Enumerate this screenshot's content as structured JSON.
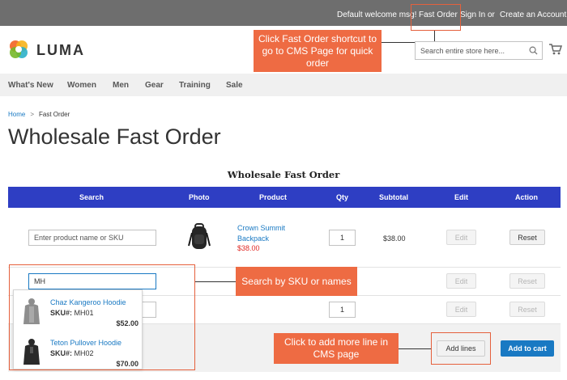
{
  "topbar": {
    "welcome": "Default welcome msg!",
    "fast_order": "Fast Order",
    "sign_in": "Sign In",
    "or": "or",
    "create_account": "Create an Account"
  },
  "logo": {
    "text": "LUMA"
  },
  "search": {
    "placeholder": "Search entire store here..."
  },
  "nav": [
    "What's New",
    "Women",
    "Men",
    "Gear",
    "Training",
    "Sale"
  ],
  "breadcrumb": {
    "home": "Home",
    "current": "Fast Order"
  },
  "page_title": "Wholesale Fast Order",
  "table": {
    "title": "Wholesale Fast Order",
    "headers": [
      "Search",
      "Photo",
      "Product",
      "Qty",
      "Subtotal",
      "Edit",
      "Action"
    ],
    "rows": [
      {
        "search_placeholder": "Enter product name or SKU",
        "product_name": "Crown Summit Backpack",
        "product_price": "$38.00",
        "qty": "1",
        "subtotal": "$38.00",
        "edit": "Edit",
        "action": "Reset"
      },
      {
        "search_value": "MH",
        "edit": "Edit",
        "action": "Reset"
      },
      {
        "qty": "1",
        "edit": "Edit",
        "action": "Reset"
      }
    ],
    "add_lines": "Add lines",
    "add_to_cart": "Add to cart"
  },
  "suggestions": [
    {
      "name": "Chaz Kangeroo Hoodie",
      "sku_label": "SKU#:",
      "sku": "MH01",
      "price": "$52.00",
      "color": "#8e8e8e"
    },
    {
      "name": "Teton Pullover Hoodie",
      "sku_label": "SKU#:",
      "sku": "MH02",
      "price": "$70.00",
      "color": "#2a2a2a"
    }
  ],
  "callouts": {
    "fast_order": "Click Fast Order shortcut to go to CMS Page for quick order",
    "search": "Search by SKU or names",
    "add_lines": "Click to add more line in CMS page"
  },
  "colors": {
    "accent": "#1979c3",
    "table_header": "#2e3ec3",
    "callout": "#ee6b43",
    "price_red": "#e02b27"
  }
}
